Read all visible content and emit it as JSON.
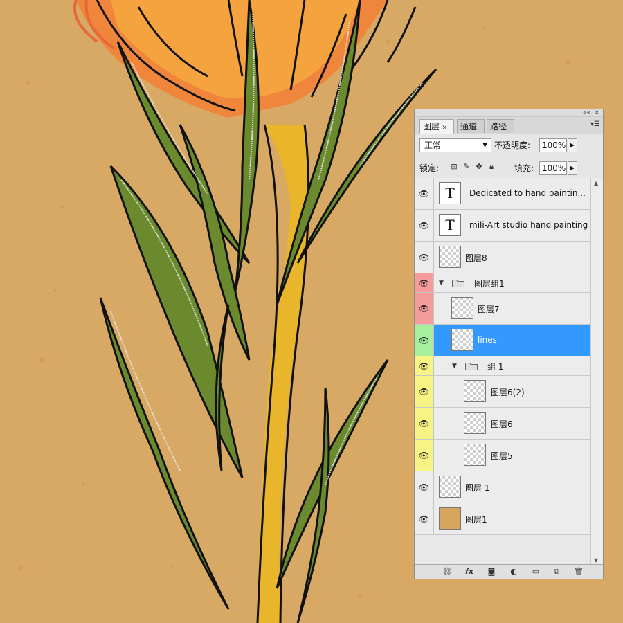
{
  "panel": {
    "tabs": [
      {
        "label": "图层",
        "close": "×"
      },
      {
        "label": "通道"
      },
      {
        "label": "路径"
      }
    ],
    "window_buttons": {
      "minimize": "««",
      "close": "×"
    },
    "panel_menu_icon": "menu-lines-icon",
    "blend_mode": "正常",
    "opacity_label": "不透明度:",
    "opacity_value": "100%",
    "lock_label": "锁定:",
    "fill_label": "填充:",
    "fill_value": "100%",
    "layers": [
      {
        "name": "Dedicated to hand paintin...",
        "kind": "text",
        "thumb_glyph": "T",
        "visible": true
      },
      {
        "name": "mili-Art studio hand painting",
        "kind": "text",
        "thumb_glyph": "T",
        "visible": true
      },
      {
        "name": "图层8",
        "kind": "pixel",
        "visible": true
      },
      {
        "name": "图层组1",
        "kind": "group",
        "expanded": true,
        "color": "red",
        "visible": true
      },
      {
        "name": "图层7",
        "kind": "pixel",
        "color": "red",
        "visible": true
      },
      {
        "name": "lines",
        "kind": "pixel",
        "color": "green",
        "selected": true,
        "visible": true
      },
      {
        "name": "组 1",
        "kind": "group",
        "expanded": true,
        "color": "yellow",
        "visible": true
      },
      {
        "name": "图层6(2)",
        "kind": "pixel",
        "color": "yellow",
        "visible": true
      },
      {
        "name": "图层6",
        "kind": "pixel",
        "color": "yellow",
        "visible": true
      },
      {
        "name": "图层5",
        "kind": "pixel",
        "color": "yellow",
        "visible": true
      },
      {
        "name": "图层 1",
        "kind": "pixel",
        "visible": true
      },
      {
        "name": "图层1",
        "kind": "fill",
        "visible": true
      }
    ],
    "bottom_icons": [
      "link-icon",
      "fx-icon",
      "mask-icon",
      "adjustment-icon",
      "new-group-icon",
      "new-layer-icon",
      "trash-icon"
    ],
    "colors": {
      "selected": "#3399ff",
      "red": "#f49b9b",
      "green": "#a6ef9d",
      "yellow": "#f7f485",
      "canvas": "#d7a964"
    }
  }
}
